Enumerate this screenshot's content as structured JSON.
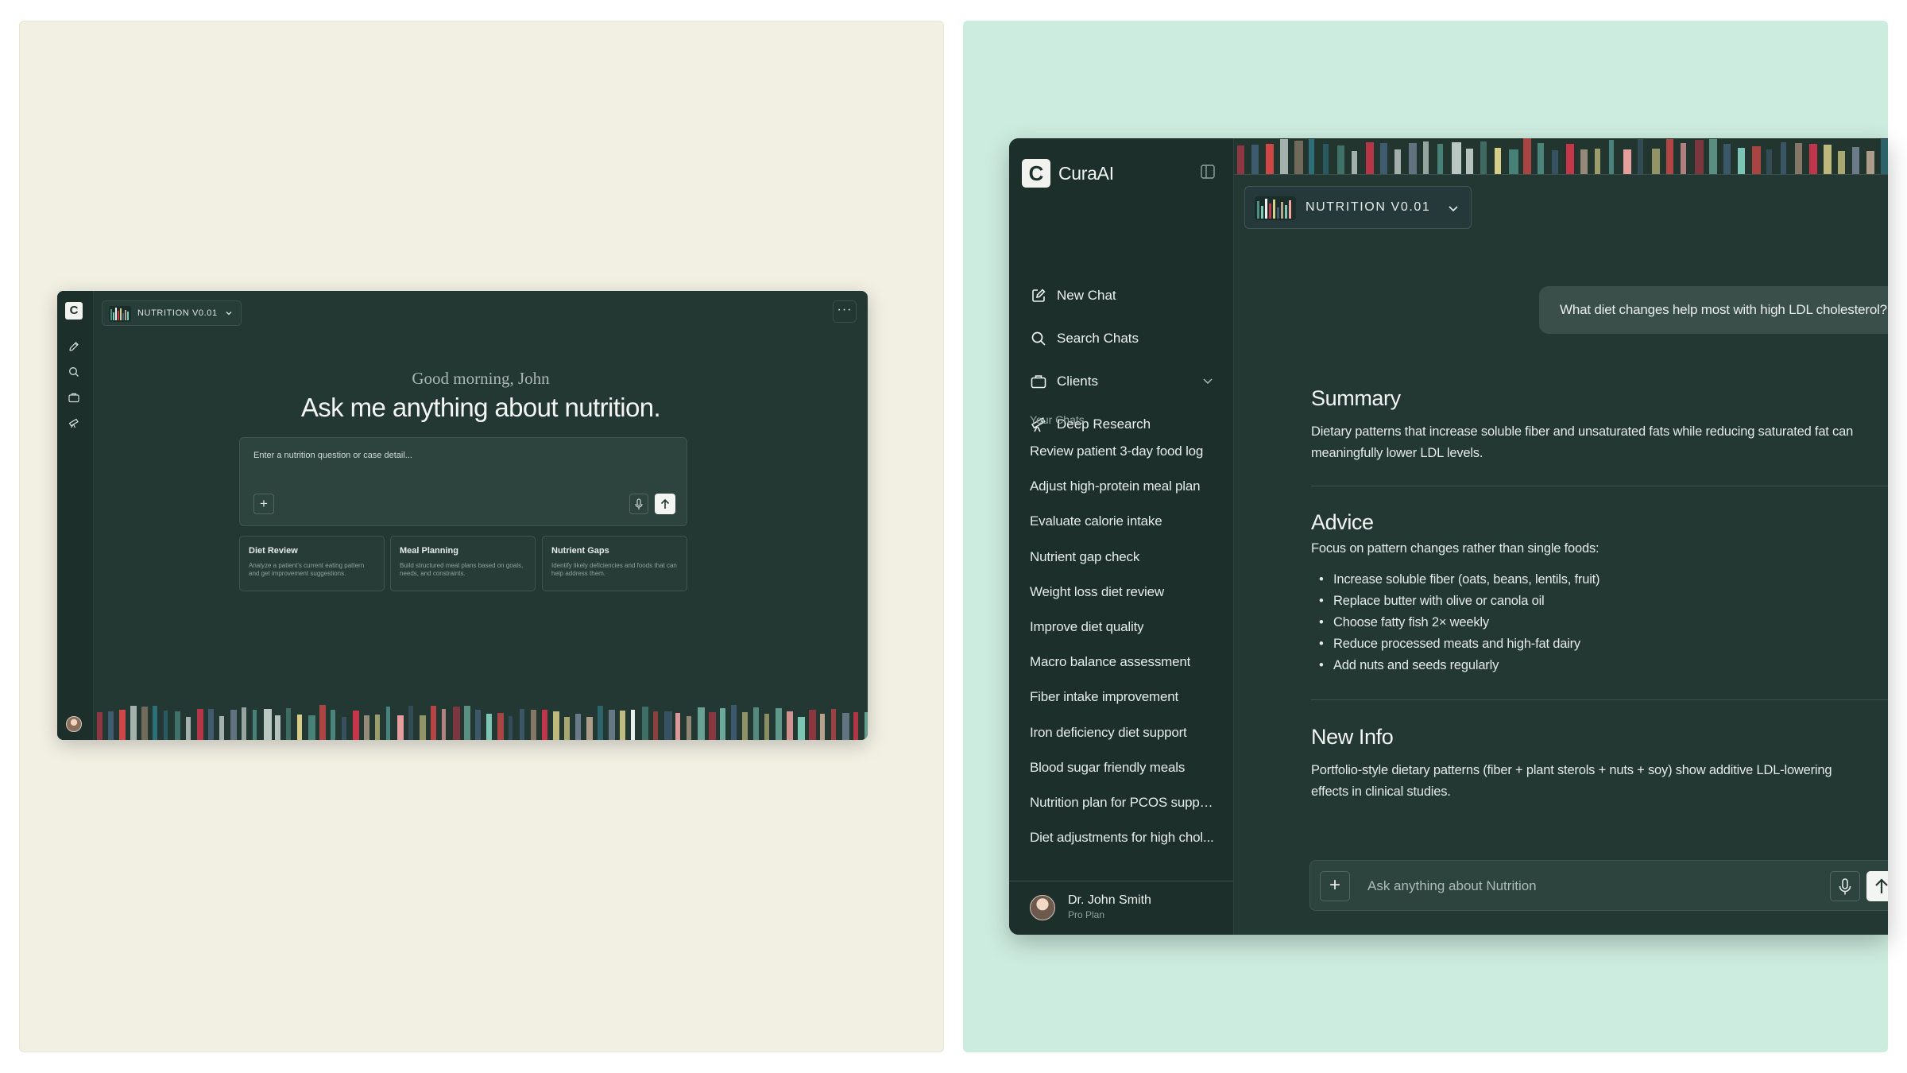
{
  "mini_window": {
    "model_label": "NUTRITION V0.01",
    "more_label": "···",
    "greeting": "Good morning, John",
    "headline": "Ask me anything about nutrition.",
    "input_placeholder": "Enter a nutrition question or case detail...",
    "plus_label": "+",
    "cards": [
      {
        "title": "Diet Review",
        "desc": "Analyze a patient's current eating pattern and get improvement suggestions."
      },
      {
        "title": "Meal Planning",
        "desc": "Build structured meal plans based on goals, needs, and constraints."
      },
      {
        "title": "Nutrient Gaps",
        "desc": "Identify likely deficiencies and foods that can help address them."
      }
    ]
  },
  "sidebar": {
    "brand": "CuraAI",
    "logo_letter": "C",
    "nav": [
      {
        "label": "New Chat",
        "icon": "pencil-square-icon"
      },
      {
        "label": "Search Chats",
        "icon": "search-icon"
      },
      {
        "label": "Clients",
        "icon": "briefcase-icon"
      },
      {
        "label": "Deep Research",
        "icon": "telescope-icon"
      }
    ],
    "section_title": "Your Chats",
    "chats": [
      "Review patient 3-day food log",
      "Adjust high-protein meal plan",
      "Evaluate calorie intake",
      "Nutrient gap check",
      "Weight loss diet review",
      "Improve diet quality",
      "Macro balance assessment",
      "Fiber intake improvement",
      "Iron deficiency diet support",
      "Blood sugar friendly meals",
      "Nutrition plan for PCOS suppo...",
      "Diet adjustments for high chol..."
    ],
    "user": {
      "name": "Dr. John Smith",
      "plan": "Pro Plan"
    }
  },
  "main": {
    "model_label": "NUTRITION V0.01",
    "user_message": "What diet changes help most with high LDL cholesterol?",
    "summary_title": "Summary",
    "summary_text": "Dietary patterns that increase soluble fiber and unsaturated fats while reducing saturated fat can meaningfully lower LDL levels.",
    "advice_title": "Advice",
    "advice_intro": "Focus on pattern changes rather than single foods:",
    "advice_items": [
      "Increase soluble fiber (oats, beans, lentils, fruit)",
      "Replace butter with olive or canola oil",
      "Choose fatty fish 2× weekly",
      "Reduce processed meats and high-fat dairy",
      "Add nuts and seeds regularly"
    ],
    "newinfo_title": "New Info",
    "newinfo_text": "Portfolio-style dietary patterns (fiber + plant sterols + nuts + soy) show additive LDL-lowering effects in clinical studies.",
    "composer_placeholder": "Ask anything about Nutrition",
    "plus_label": "+"
  },
  "colors": {
    "left_background": "#f1f0e3",
    "right_background": "#cdece0",
    "app_background": "#233733",
    "sidebar_background": "#1d2f2b",
    "bar_palette": [
      "#3f5d73",
      "#c7364a",
      "#f3a6a6",
      "#e04a4a",
      "#7fc9b8",
      "#e8f2ee",
      "#8a7a68",
      "#b9a590",
      "#4f8f86",
      "#6e7e8e",
      "#d8cf8a",
      "#2f6f7a"
    ]
  }
}
